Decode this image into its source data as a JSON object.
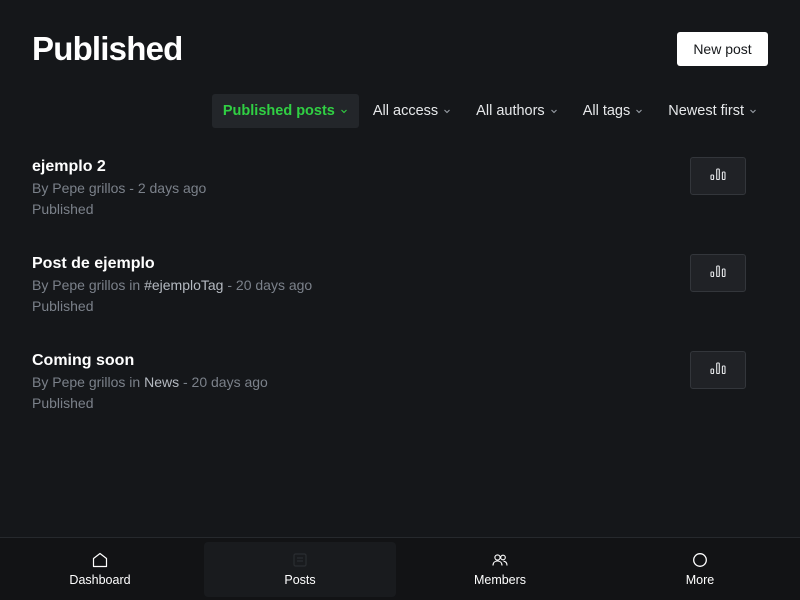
{
  "header": {
    "title": "Published",
    "new_post_label": "New post"
  },
  "filters": [
    {
      "label": "Published posts",
      "active": true
    },
    {
      "label": "All access",
      "active": false
    },
    {
      "label": "All authors",
      "active": false
    },
    {
      "label": "All tags",
      "active": false
    },
    {
      "label": "Newest first",
      "active": false
    }
  ],
  "posts": [
    {
      "title": "ejemplo 2",
      "by": "By Pepe grillos",
      "in": "",
      "tag": "",
      "time": " - 2 days ago",
      "status": "Published"
    },
    {
      "title": "Post de ejemplo",
      "by": "By Pepe grillos",
      "in": " in ",
      "tag": "#ejemploTag",
      "time": " - 20 days ago",
      "status": "Published"
    },
    {
      "title": "Coming soon",
      "by": "By Pepe grillos",
      "in": " in ",
      "tag": "News",
      "time": " - 20 days ago",
      "status": "Published"
    }
  ],
  "nav": [
    {
      "label": "Dashboard",
      "icon": "home-icon",
      "active": false
    },
    {
      "label": "Posts",
      "icon": "posts-icon",
      "active": true
    },
    {
      "label": "Members",
      "icon": "members-icon",
      "active": false
    },
    {
      "label": "More",
      "icon": "more-icon",
      "active": false
    }
  ],
  "colors": {
    "background": "#15171a",
    "accent_green": "#30cf43",
    "muted_text": "#7b818a"
  }
}
